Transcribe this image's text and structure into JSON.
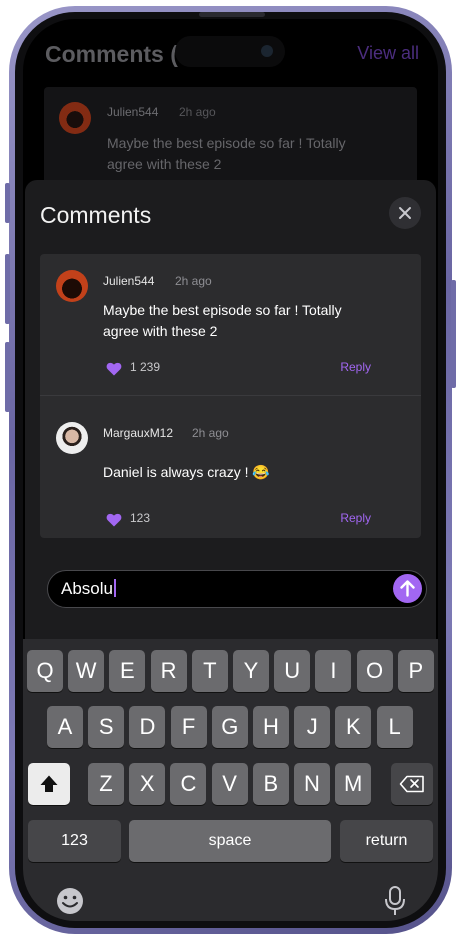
{
  "background_page": {
    "title": "Comments (",
    "view_all_label": "View all",
    "comment": {
      "username": "Julien544",
      "time": "2h ago",
      "text": "Maybe the best episode so far ! Totally agree with these 2"
    }
  },
  "sheet": {
    "title": "Comments",
    "close_icon": "close-icon",
    "comments": [
      {
        "username": "Julien544",
        "time": "2h ago",
        "text": "Maybe the best episode so far ! Totally agree with these 2",
        "likes": "1 239",
        "reply_label": "Reply"
      },
      {
        "username": "MargauxM12",
        "time": "2h ago",
        "text": "Daniel is always crazy ! 😂",
        "likes": "123",
        "reply_label": "Reply"
      }
    ]
  },
  "composer": {
    "value": "Absolu",
    "send_icon": "arrow-up-icon"
  },
  "keyboard": {
    "row1": [
      "Q",
      "W",
      "E",
      "R",
      "T",
      "Y",
      "U",
      "I",
      "O",
      "P"
    ],
    "row2": [
      "A",
      "S",
      "D",
      "F",
      "G",
      "H",
      "J",
      "K",
      "L"
    ],
    "row3": [
      "Z",
      "X",
      "C",
      "V",
      "B",
      "N",
      "M"
    ],
    "numbers_label": "123",
    "space_label": "space",
    "return_label": "return",
    "shift_icon": "shift-icon",
    "delete_icon": "backspace-icon",
    "emoji_icon": "emoji-icon",
    "mic_icon": "microphone-icon"
  },
  "colors": {
    "accent": "#a267f2",
    "sheet_bg": "#1c1c1e",
    "card_bg": "#2c2c2e",
    "frame": "#7d7ab5"
  }
}
